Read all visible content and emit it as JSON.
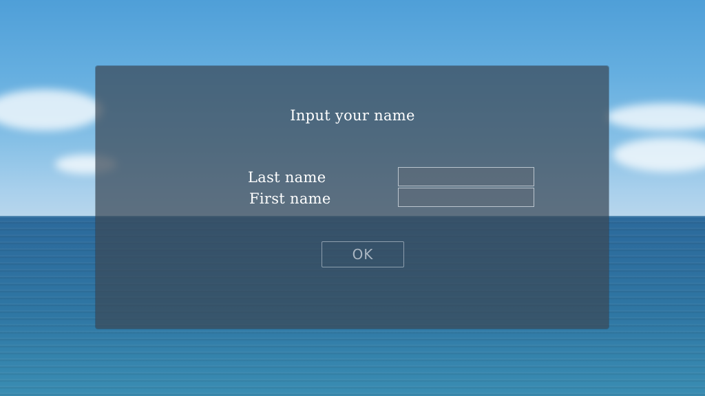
{
  "dialog": {
    "title": "Input your name",
    "fields": [
      {
        "label": "Last name",
        "value": "",
        "placeholder": ""
      },
      {
        "label": "First name",
        "value": "",
        "placeholder": ""
      }
    ],
    "ok_label": "OK"
  },
  "colors": {
    "sky": "#66afe0",
    "ocean": "#2f77a4",
    "panel": "#3a4856",
    "text": "#ffffff"
  }
}
